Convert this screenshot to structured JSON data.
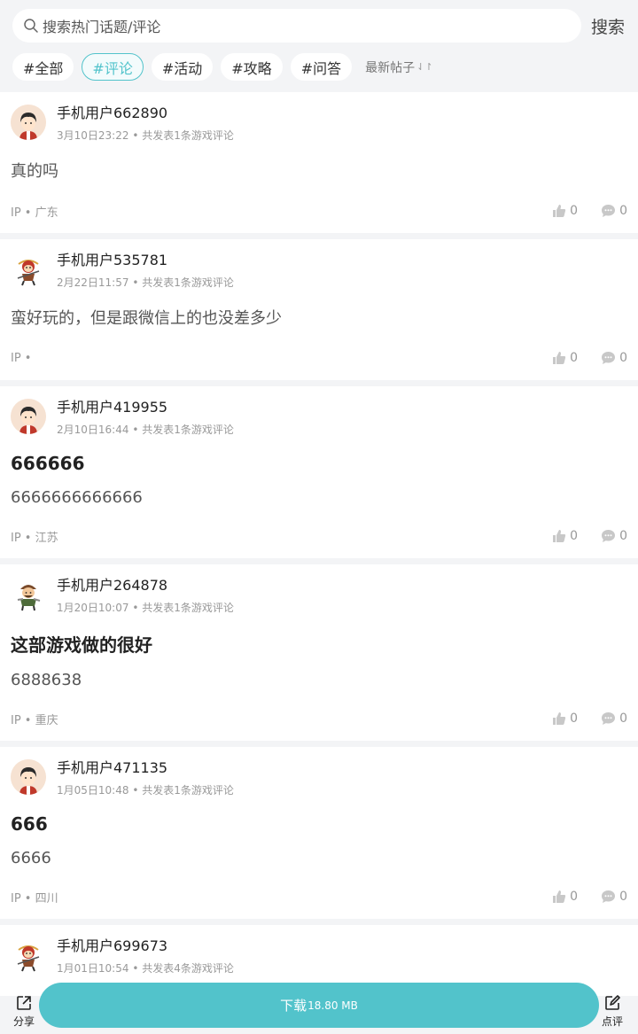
{
  "search": {
    "placeholder": "搜索热门话题/评论",
    "button_label": "搜索"
  },
  "tags": [
    {
      "label": "#全部",
      "active": false
    },
    {
      "label": "#评论",
      "active": true
    },
    {
      "label": "#活动",
      "active": false
    },
    {
      "label": "#攻略",
      "active": false
    },
    {
      "label": "#问答",
      "active": false
    }
  ],
  "sort": {
    "label": "最新帖子",
    "icon": "sort-arrows-icon"
  },
  "posts": [
    {
      "username": "手机用户662890",
      "avatar": "boy-avatar-icon",
      "time": "3月10日23:22",
      "summary": "共发表1条游戏评论",
      "title": "",
      "text": "真的吗",
      "ip": "IP • 广东",
      "likes": "0",
      "comments": "0"
    },
    {
      "username": "手机用户535781",
      "avatar": "monkey-king-avatar-icon",
      "time": "2月22日11:57",
      "summary": "共发表1条游戏评论",
      "title": "",
      "text": "蛮好玩的，但是跟微信上的也没差多少",
      "ip": "IP •",
      "likes": "0",
      "comments": "0"
    },
    {
      "username": "手机用户419955",
      "avatar": "boy-avatar-icon",
      "time": "2月10日16:44",
      "summary": "共发表1条游戏评论",
      "title": "666666",
      "text": "6666666666666",
      "ip": "IP • 江苏",
      "likes": "0",
      "comments": "0"
    },
    {
      "username": "手机用户264878",
      "avatar": "warrior-avatar-icon",
      "time": "1月20日10:07",
      "summary": "共发表1条游戏评论",
      "title": "这部游戏做的很好",
      "text": "6888638",
      "ip": "IP • 重庆",
      "likes": "0",
      "comments": "0"
    },
    {
      "username": "手机用户471135",
      "avatar": "boy-avatar-icon",
      "time": "1月05日10:48",
      "summary": "共发表1条游戏评论",
      "title": "666",
      "text": "6666",
      "ip": "IP • 四川",
      "likes": "0",
      "comments": "0"
    },
    {
      "username": "手机用户699673",
      "avatar": "monkey-king-avatar-icon",
      "time": "1月01日10:54",
      "summary": "共发表4条游戏评论",
      "title": "",
      "text": "",
      "ip": "",
      "likes": "",
      "comments": ""
    }
  ],
  "bottom": {
    "share_label": "分享",
    "download_label": "下载",
    "download_size": "18.80 MB",
    "review_label": "点评"
  },
  "colors": {
    "accent": "#52c3cb",
    "meta": "#999999",
    "background": "#f3f4f6"
  }
}
